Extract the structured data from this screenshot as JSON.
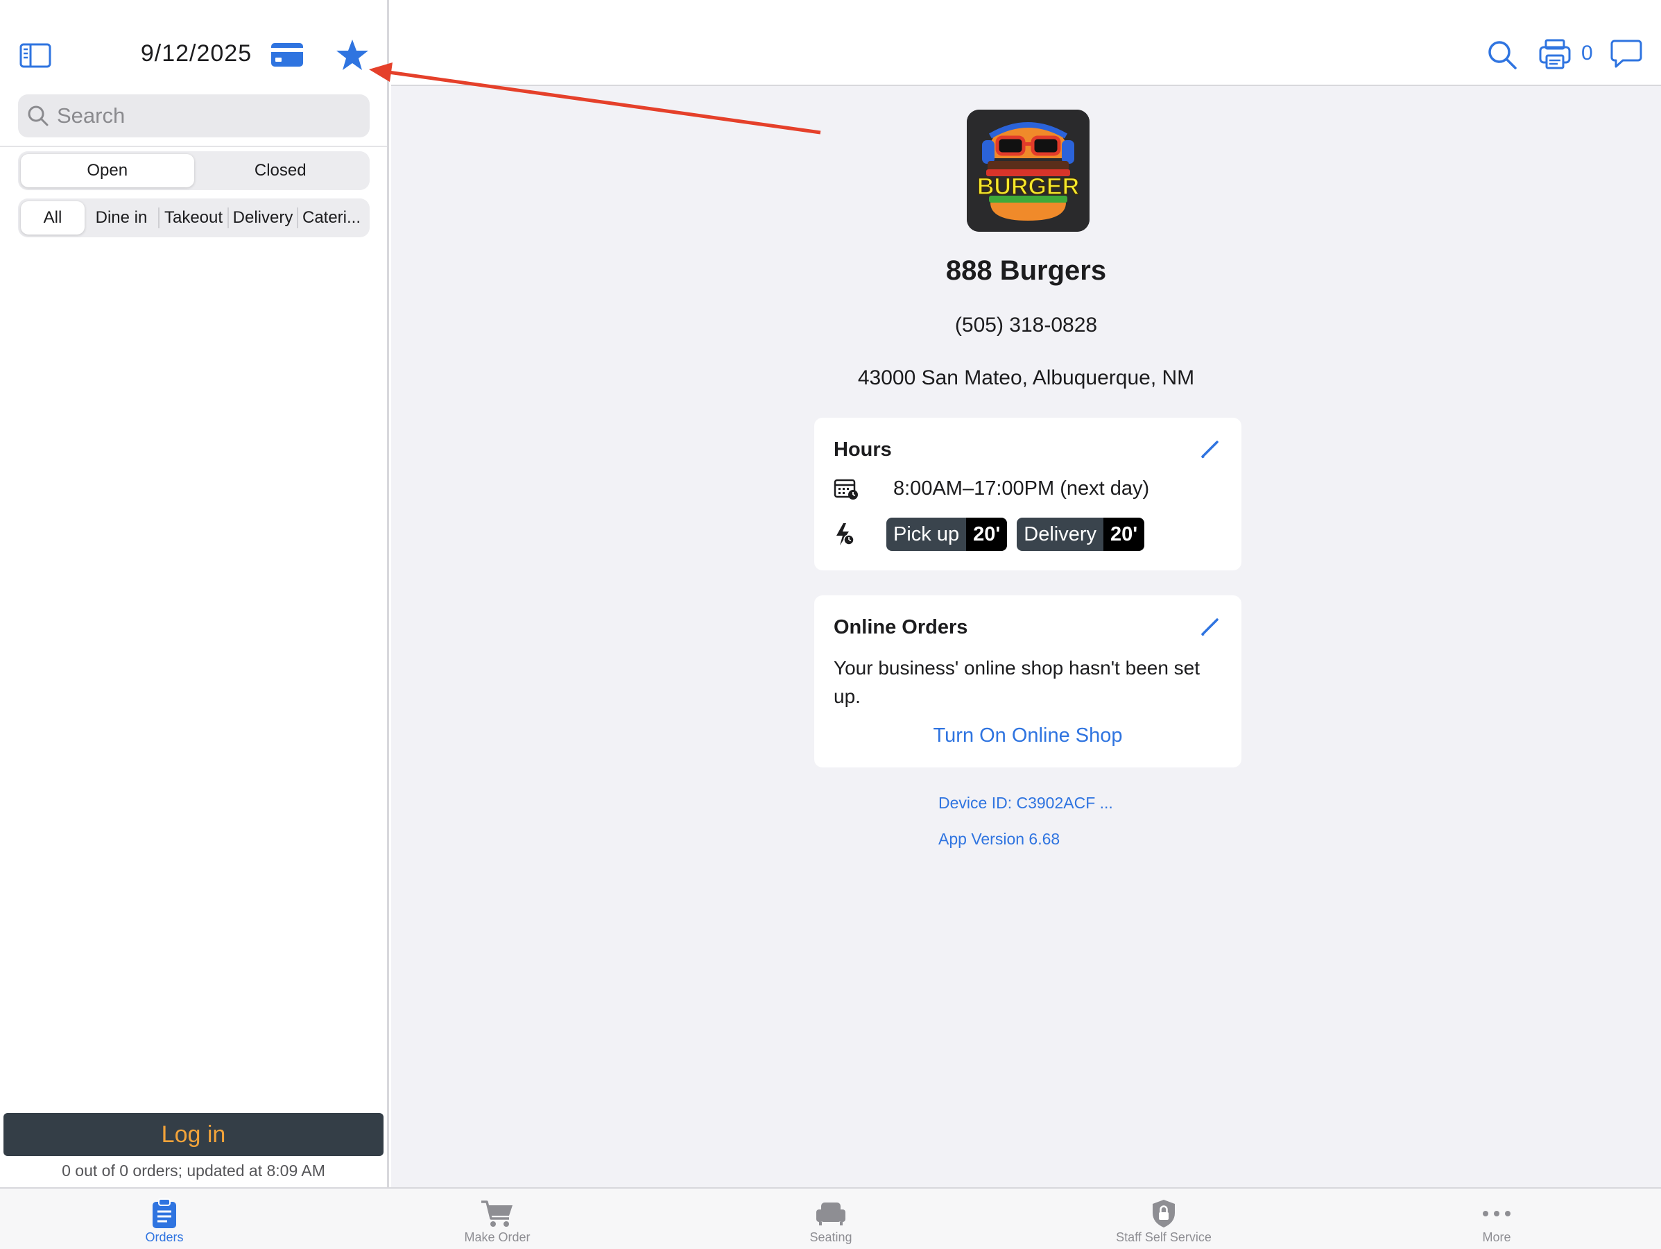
{
  "sidebar": {
    "date": "9/12/2025",
    "search": {
      "placeholder": "Search"
    },
    "status_tabs": [
      {
        "label": "Open",
        "active": true
      },
      {
        "label": "Closed",
        "active": false
      }
    ],
    "order_types": [
      {
        "label": "All",
        "active": true
      },
      {
        "label": "Dine in",
        "active": false
      },
      {
        "label": "Takeout",
        "active": false
      },
      {
        "label": "Delivery",
        "active": false
      },
      {
        "label": "Cateri...",
        "active": false
      }
    ],
    "login_label": "Log in",
    "orders_status": "0 out of 0 orders; updated at 8:09 AM"
  },
  "topbar": {
    "printer_count": "0"
  },
  "store": {
    "name": "888 Burgers",
    "phone": "(505) 318-0828",
    "address": "43000 San Mateo, Albuquerque, NM",
    "logo_text": "BURGER"
  },
  "hours_card": {
    "title": "Hours",
    "hours": "8:00AM–17:00PM (next day)",
    "pickup": {
      "label": "Pick up",
      "value": "20'"
    },
    "delivery": {
      "label": "Delivery",
      "value": "20'"
    }
  },
  "online_card": {
    "title": "Online Orders",
    "message": "Your business' online shop hasn't been set up.",
    "link_label": "Turn On Online Shop"
  },
  "device_id": "Device ID: C3902ACF ...",
  "app_version": "App Version 6.68",
  "tabbar": [
    {
      "label": "Orders",
      "active": true
    },
    {
      "label": "Make Order",
      "active": false
    },
    {
      "label": "Seating",
      "active": false
    },
    {
      "label": "Staff Self Service",
      "active": false
    },
    {
      "label": "More",
      "active": false
    }
  ],
  "colors": {
    "accent": "#2f74e0",
    "login_bg": "#343e47",
    "login_text": "#f2a33a",
    "annotation": "#e5402a"
  }
}
